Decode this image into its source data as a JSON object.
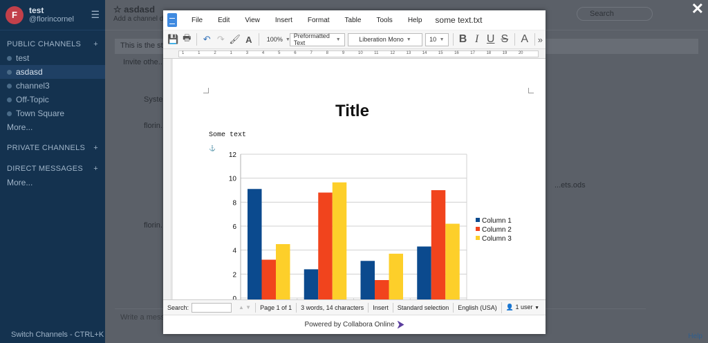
{
  "background_app": {
    "team": {
      "initial": "F",
      "name": "test",
      "handle": "@florincornel"
    },
    "sidebar": {
      "public_title": "PUBLIC CHANNELS",
      "channels": [
        "test",
        "asdasd",
        "channel3",
        "Off-Topic",
        "Town Square"
      ],
      "more_label": "More...",
      "private_title": "PRIVATE CHANNELS",
      "direct_title": "DIRECT MESSAGES",
      "direct_more": "More...",
      "footer": "Switch Channels - CTRL+K"
    },
    "channel": {
      "name": "asdasd",
      "purpose": "Add a channel de...",
      "search_placeholder": "Search",
      "banner": "This is the sta...",
      "invite": "Invite othe...",
      "system_label": "Syste...",
      "user_label_1": "florin...",
      "user_label_2": "florin...",
      "file_name": "...ets.ods",
      "input_placeholder": "Write a mess...",
      "help": "Help"
    }
  },
  "editor": {
    "menu": [
      "File",
      "Edit",
      "View",
      "Insert",
      "Format",
      "Table",
      "Tools",
      "Help"
    ],
    "doc_title": "some text.txt",
    "zoom": "100%",
    "paragraph_style": "Preformatted Text",
    "font_name": "Liberation Mono",
    "font_size": "10",
    "format_buttons": [
      "B",
      "I",
      "U",
      "S"
    ],
    "ruler_numbers": [
      "1",
      "1",
      "2",
      "1",
      "3",
      "4",
      "5",
      "6",
      "7",
      "8",
      "9",
      "10",
      "11",
      "12",
      "13",
      "14",
      "15",
      "16",
      "17",
      "18",
      "19",
      "20"
    ],
    "heading": "Title",
    "body_text": "Some text",
    "statusbar": {
      "search_label": "Search:",
      "page": "Page 1 of 1",
      "words": "3 words, 14 characters",
      "mode": "Insert",
      "selection": "Standard selection",
      "language": "English (USA)",
      "users": "1 user"
    },
    "powered_by": "Powered by Collabora Online"
  },
  "colors": {
    "column1": "#0b4a8e",
    "column2": "#f1441d",
    "column3": "#fdcf2a"
  },
  "chart_data": {
    "type": "bar",
    "categories": [
      "",
      "",
      "",
      ""
    ],
    "series": [
      {
        "name": "Column 1",
        "values": [
          9.1,
          2.4,
          3.1,
          4.3
        ]
      },
      {
        "name": "Column 2",
        "values": [
          3.2,
          8.8,
          1.5,
          9.0
        ]
      },
      {
        "name": "Column 3",
        "values": [
          4.5,
          9.65,
          3.7,
          6.2
        ]
      }
    ],
    "ylim": [
      0,
      12
    ],
    "yticks": [
      0,
      2,
      4,
      6,
      8,
      10,
      12
    ],
    "grid": true,
    "legend": "right"
  }
}
